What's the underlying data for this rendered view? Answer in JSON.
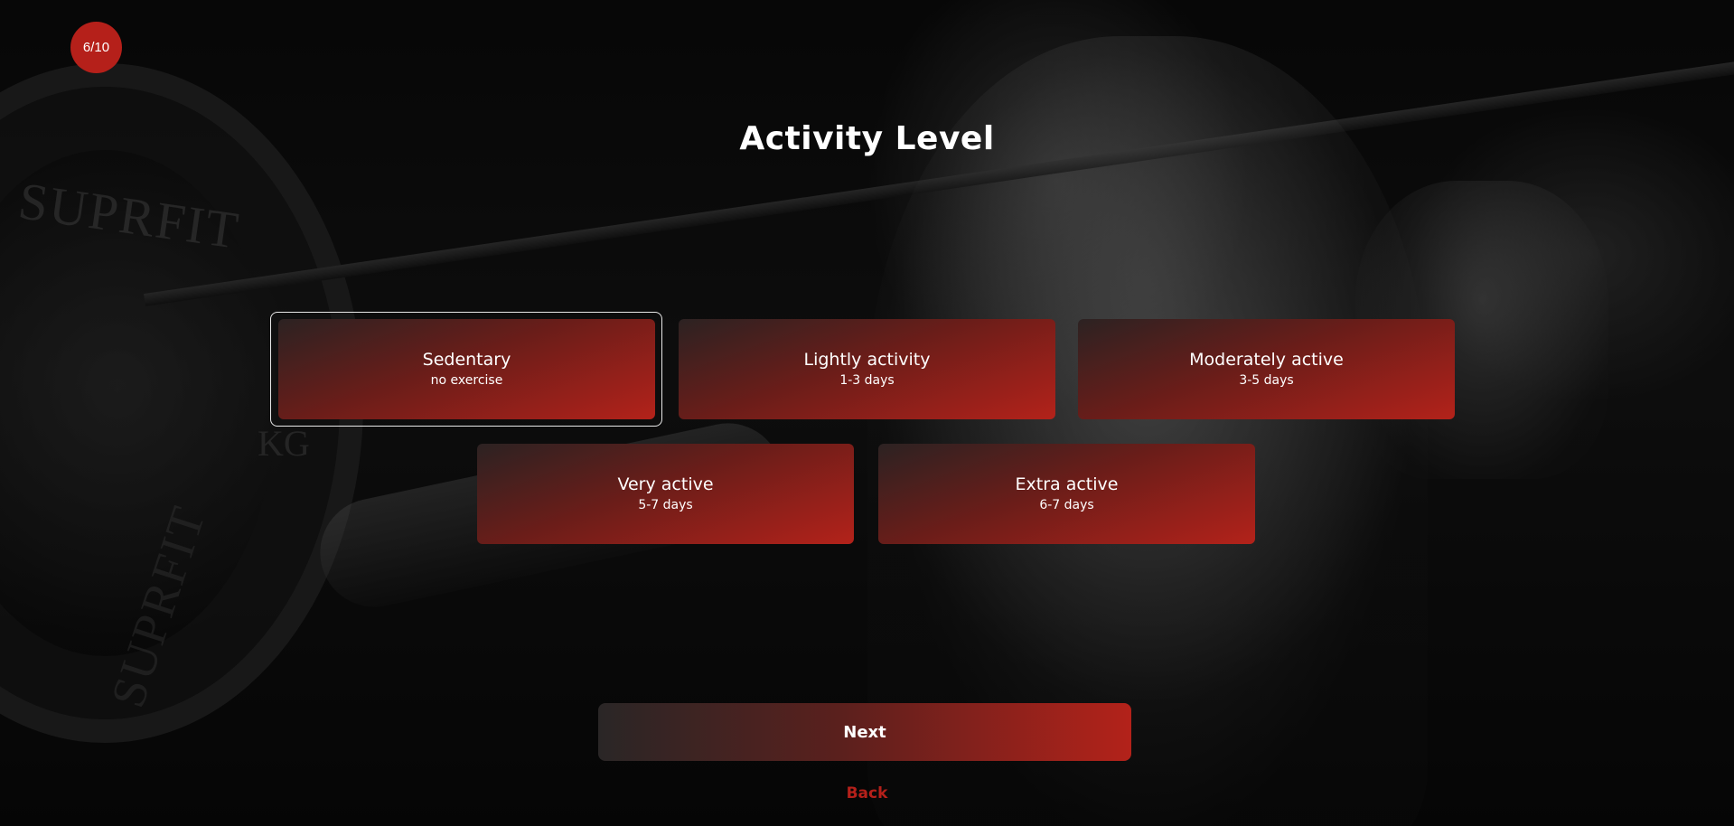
{
  "progress": {
    "label": "6/10",
    "current": 6,
    "total": 10
  },
  "page": {
    "title": "Activity Level"
  },
  "options": [
    {
      "label": "Sedentary",
      "sub": "no exercise",
      "selected": true
    },
    {
      "label": "Lightly activity",
      "sub": "1-3 days",
      "selected": false
    },
    {
      "label": "Moderately active",
      "sub": "3-5 days",
      "selected": false
    },
    {
      "label": "Very active",
      "sub": "5-7 days",
      "selected": false
    },
    {
      "label": "Extra active",
      "sub": "6-7 days",
      "selected": false
    }
  ],
  "actions": {
    "next_label": "Next",
    "back_label": "Back"
  },
  "background": {
    "plate_text_top": "SUPRFIT",
    "plate_text_bottom": "SUPRFIT",
    "plate_unit": "KG"
  },
  "colors": {
    "accent": "#b5201a",
    "card_gradient_start": "#2c2222",
    "card_gradient_end": "#b3221a",
    "text": "#ffffff"
  }
}
